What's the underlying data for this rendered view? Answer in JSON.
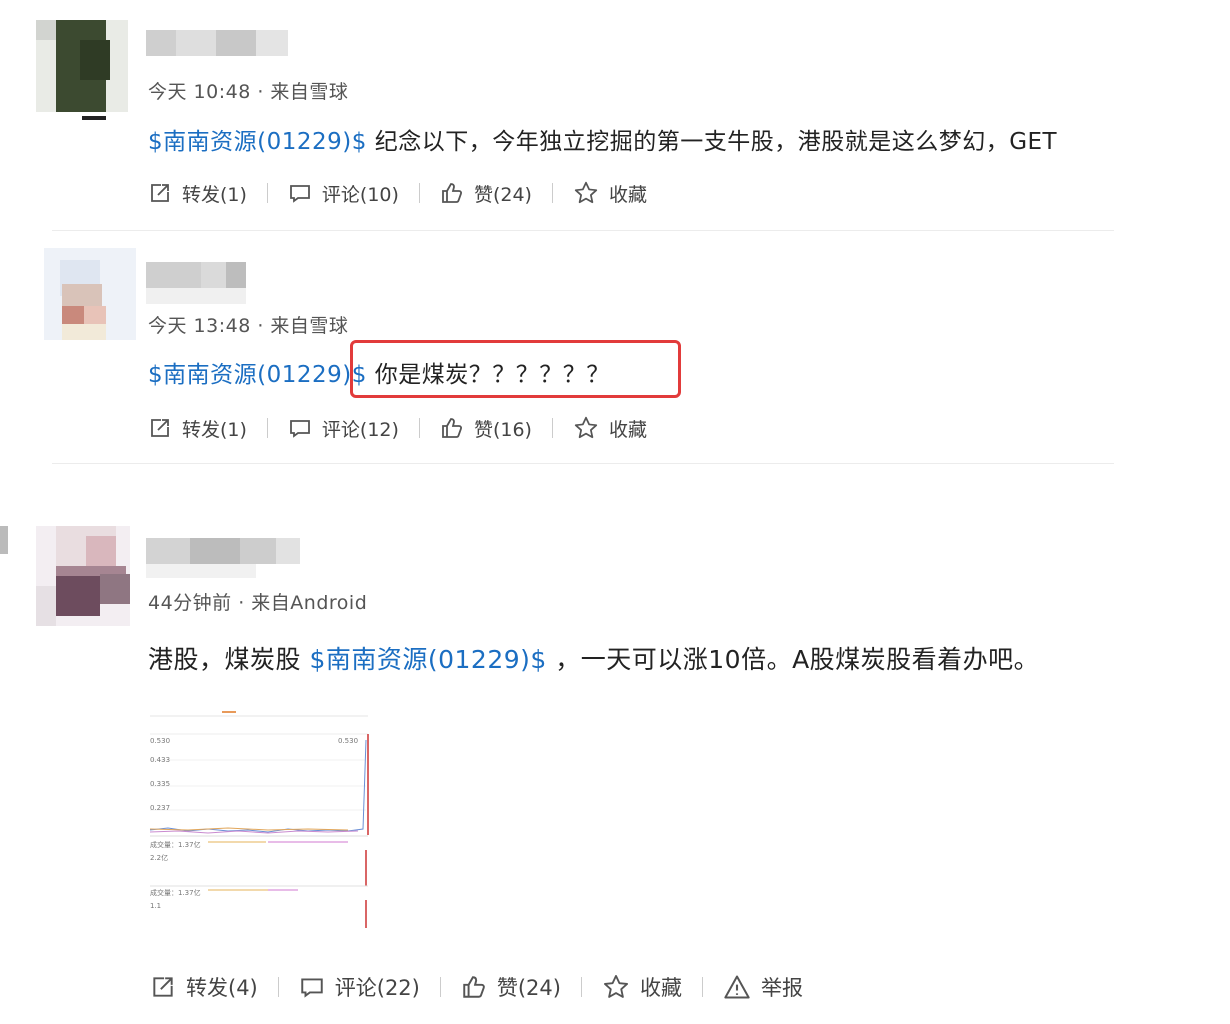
{
  "posts": [
    {
      "meta": "今天 10:48 · 来自雪球",
      "stock_tag": "$南南资源(01229)$",
      "text": " 纪念以下，今年独立挖掘的第一支牛股，港股就是这么梦幻，GET",
      "actions": {
        "repost": "转发(1)",
        "comment": "评论(10)",
        "like": "赞(24)",
        "favorite": "收藏"
      }
    },
    {
      "meta": "今天 13:48 · 来自雪球",
      "stock_tag": "$南南资源(01229)$",
      "text": " 你是煤炭？？？？？？",
      "actions": {
        "repost": "转发(1)",
        "comment": "评论(12)",
        "like": "赞(16)",
        "favorite": "收藏"
      }
    },
    {
      "meta": "44分钟前 · 来自Android",
      "text_before": "港股，煤炭股 ",
      "stock_tag": "$南南资源(01229)$",
      "text_after": " ，一天可以涨10倍。A股煤炭股看着办吧。",
      "actions": {
        "repost": "转发(4)",
        "comment": "评论(22)",
        "like": "赞(24)",
        "favorite": "收藏",
        "report": "举报"
      },
      "thumbnail": {
        "y_ticks": [
          "0.530",
          "0.433",
          "0.335",
          "0.237"
        ],
        "last_label": "0.530",
        "volume_label": "成交量：1.37亿",
        "volume_ticks": [
          "2.2亿",
          "1.1"
        ]
      }
    }
  ],
  "colors": {
    "link": "#1b6ec2",
    "highlight": "#e23b3b"
  }
}
